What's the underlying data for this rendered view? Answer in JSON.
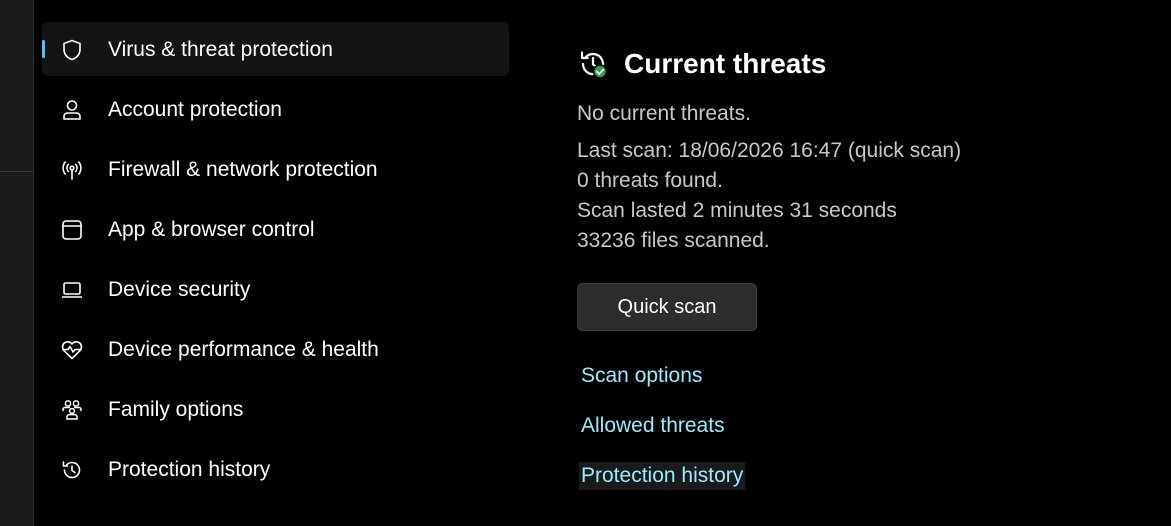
{
  "colors": {
    "background": "#000000",
    "accent": "#4cc2ff",
    "link": "#99ebff",
    "secondary_text": "#c8c8c8",
    "ok_badge": "#2ea043"
  },
  "sidebar": {
    "items": [
      {
        "label": "Virus & threat protection",
        "icon": "shield-icon",
        "selected": true
      },
      {
        "label": "Account protection",
        "icon": "person-icon"
      },
      {
        "label": "Firewall & network protection",
        "icon": "wireless-antenna-icon"
      },
      {
        "label": "App & browser control",
        "icon": "browser-window-icon"
      },
      {
        "label": "Device security",
        "icon": "laptop-icon"
      },
      {
        "label": "Device performance & health",
        "icon": "heart-pulse-icon"
      },
      {
        "label": "Family options",
        "icon": "family-icon"
      },
      {
        "label": "Protection history",
        "icon": "history-icon"
      }
    ]
  },
  "main": {
    "title": "Current threats",
    "title_icon": "history-check-icon",
    "status": "No current threats.",
    "details": [
      "Last scan: 18/06/2026 16:47 (quick scan)",
      "0 threats found.",
      "Scan lasted 2 minutes 31 seconds",
      "33236 files scanned."
    ],
    "quick_scan_label": "Quick scan",
    "links": [
      "Scan options",
      "Allowed threats",
      "Protection history"
    ]
  }
}
